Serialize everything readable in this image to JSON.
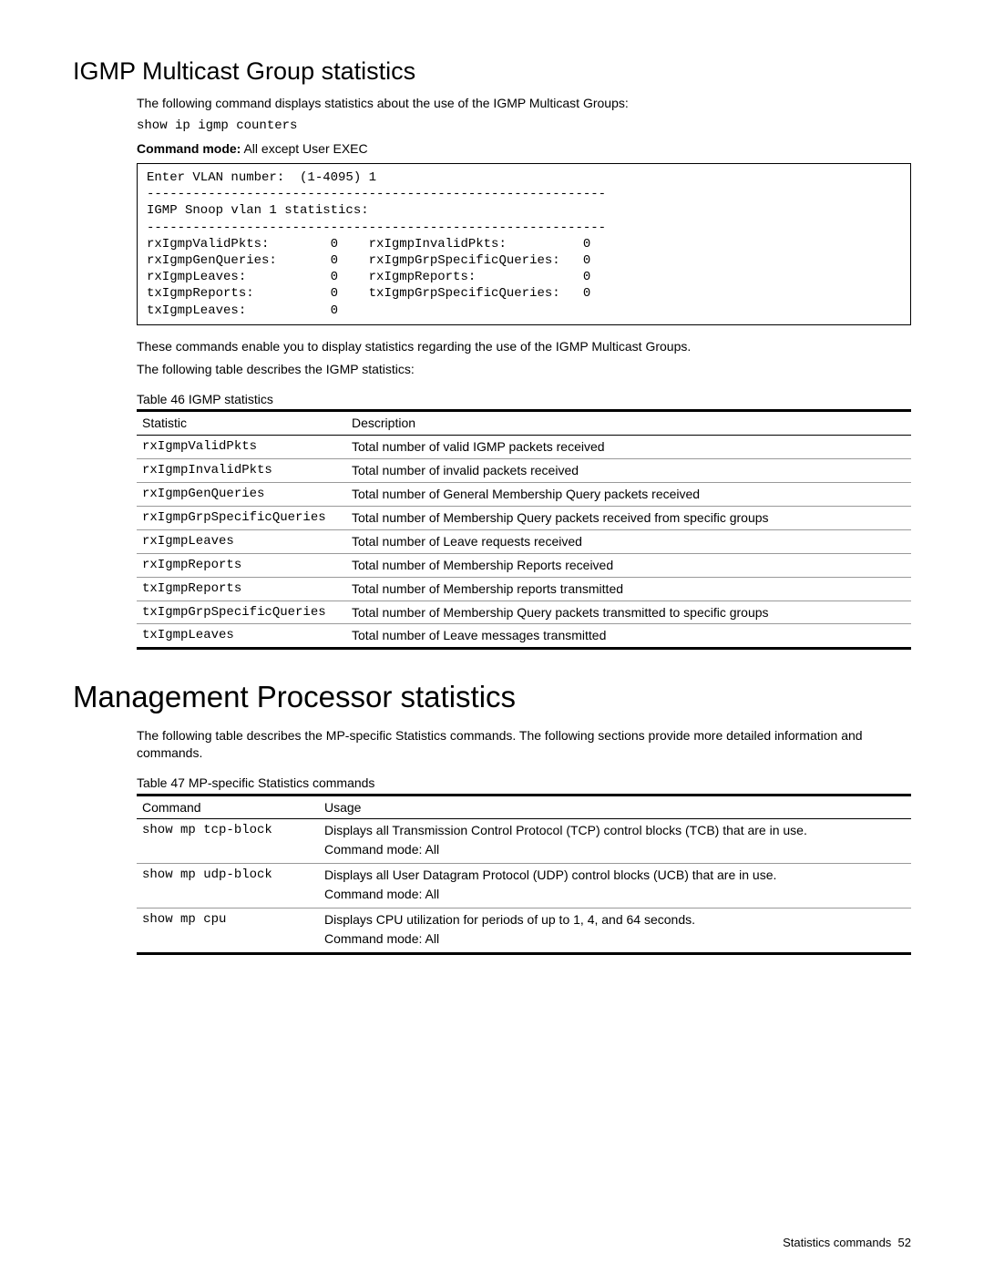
{
  "section1": {
    "heading": "IGMP Multicast Group statistics",
    "intro": "The following command displays statistics about the use of the IGMP Multicast Groups:",
    "command": "show ip igmp counters",
    "mode_label": "Command mode:",
    "mode_value": " All except User EXEC",
    "output": "Enter VLAN number:  (1-4095) 1\n------------------------------------------------------------\nIGMP Snoop vlan 1 statistics:\n------------------------------------------------------------\nrxIgmpValidPkts:        0    rxIgmpInvalidPkts:          0\nrxIgmpGenQueries:       0    rxIgmpGrpSpecificQueries:   0\nrxIgmpLeaves:           0    rxIgmpReports:              0\ntxIgmpReports:          0    txIgmpGrpSpecificQueries:   0\ntxIgmpLeaves:           0",
    "after1": "These commands enable you to display statistics regarding the use of the IGMP Multicast Groups.",
    "after2": "The following table describes the IGMP statistics:",
    "table_caption": "Table 46  IGMP statistics",
    "table_headers": {
      "stat": "Statistic",
      "desc": "Description"
    },
    "table_rows": [
      {
        "stat": "rxIgmpValidPkts",
        "desc": "Total number of valid IGMP packets received"
      },
      {
        "stat": "rxIgmpInvalidPkts",
        "desc": "Total number of invalid packets received"
      },
      {
        "stat": "rxIgmpGenQueries",
        "desc": "Total number of General Membership Query packets received"
      },
      {
        "stat": "rxIgmpGrpSpecificQueries",
        "desc": "Total number of Membership Query packets received from specific groups"
      },
      {
        "stat": "rxIgmpLeaves",
        "desc": "Total number of Leave requests received"
      },
      {
        "stat": "rxIgmpReports",
        "desc": "Total number of Membership Reports received"
      },
      {
        "stat": "txIgmpReports",
        "desc": "Total number of Membership reports transmitted"
      },
      {
        "stat": "txIgmpGrpSpecificQueries",
        "desc": "Total number of Membership Query packets transmitted to specific groups"
      },
      {
        "stat": "txIgmpLeaves",
        "desc": "Total number of Leave messages transmitted"
      }
    ]
  },
  "section2": {
    "heading": "Management Processor statistics",
    "intro": "The following table describes the MP-specific Statistics commands. The following sections provide more detailed information and commands.",
    "table_caption": "Table 47  MP-specific Statistics commands",
    "table_headers": {
      "cmd": "Command",
      "usage": "Usage"
    },
    "table_rows": [
      {
        "cmd": "show mp tcp-block",
        "usage1": "Displays all Transmission Control Protocol (TCP) control blocks (TCB) that are in use.",
        "usage2": "Command mode: All"
      },
      {
        "cmd": "show mp udp-block",
        "usage1": "Displays all User Datagram Protocol (UDP) control blocks (UCB) that are in use.",
        "usage2": "Command mode: All"
      },
      {
        "cmd": "show mp cpu",
        "usage1": "Displays CPU utilization for periods of up to 1, 4, and 64 seconds.",
        "usage2": "Command mode: All"
      }
    ]
  },
  "footer": {
    "label": "Statistics commands",
    "page": "52"
  }
}
